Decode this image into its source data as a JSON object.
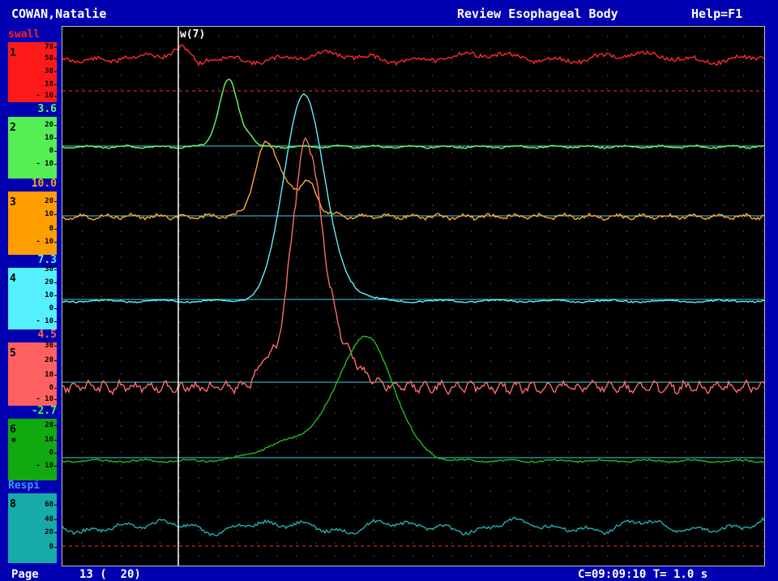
{
  "header": {
    "patient": "COWAN,Natalie",
    "mode": "Review Esophageal Body",
    "help": "Help=F1"
  },
  "status": {
    "page_label": "Page",
    "page_value": "13 (  20)",
    "time": "C=09:09:10 T= 1.0 s"
  },
  "marker": {
    "label": "w(7)"
  },
  "channels": [
    {
      "header": "swall",
      "header_color": "#ff2020",
      "number": "1",
      "star": "",
      "color": "#ff1a1a",
      "trace_color": "#ff2a2a",
      "ticks": [
        "70",
        "50",
        "30",
        "10",
        "- 10"
      ],
      "baseline_kind": "dashed"
    },
    {
      "header": "3.6",
      "header_color": "#60ff60",
      "number": "2",
      "star": "",
      "color": "#55ee55",
      "trace_color": "#66ff66",
      "ticks": [
        "20",
        "10",
        "0",
        "- 10"
      ],
      "baseline_kind": "solid"
    },
    {
      "header": "10.0",
      "header_color": "#ffa020",
      "number": "3",
      "star": "",
      "color": "#ff9e00",
      "trace_color": "#ffa830",
      "ticks": [
        "20",
        "10",
        "0",
        "- 10"
      ],
      "baseline_kind": "solid"
    },
    {
      "header": "7.3",
      "header_color": "#40ffff",
      "number": "4",
      "star": "",
      "color": "#55f0ff",
      "trace_color": "#60f0ff",
      "ticks": [
        "30",
        "20",
        "10",
        "0",
        "- 10"
      ],
      "baseline_kind": "solid"
    },
    {
      "header": "4.5",
      "header_color": "#ff6060",
      "number": "5",
      "star": "",
      "color": "#ff6060",
      "trace_color": "#ff6a6a",
      "ticks": [
        "30",
        "20",
        "10",
        "0",
        "- 10"
      ],
      "baseline_kind": "solid"
    },
    {
      "header": "-2.7",
      "header_color": "#40ff40",
      "number": "6",
      "star": "*",
      "color": "#10aa10",
      "trace_color": "#22bb22",
      "ticks": [
        "20",
        "10",
        "0",
        "- 10"
      ],
      "baseline_kind": "solid"
    },
    {
      "header": "Respi",
      "header_color": "#4090ff",
      "number": "8",
      "star": "",
      "color": "#16aaa8",
      "trace_color": "#20b0b0",
      "ticks": [
        "60",
        "40",
        "20",
        "0"
      ],
      "baseline_kind": "dashed"
    }
  ]
}
